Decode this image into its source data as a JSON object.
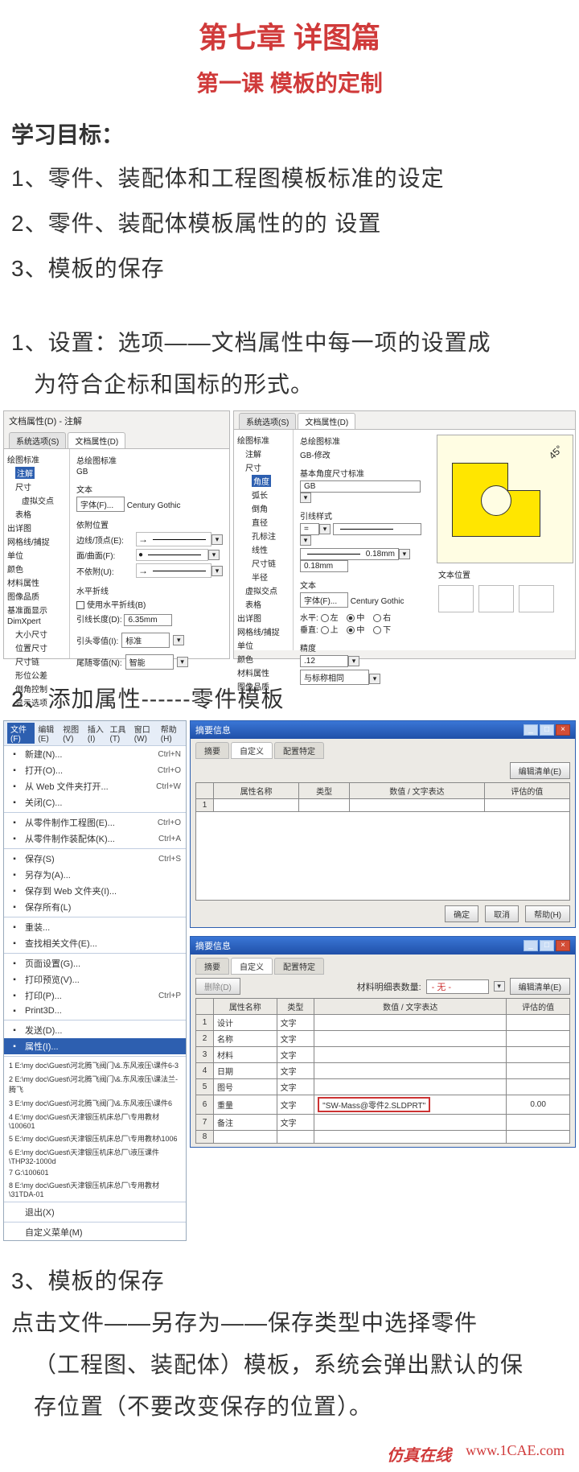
{
  "chapter_title": "第七章 详图篇",
  "lesson_title": "第一课   模板的定制",
  "goal_head": "学习目标：",
  "goals": [
    "1、零件、装配体和工程图模板标准的设定",
    "2、零件、装配体模板属性的的 设置",
    "3、模板的保存"
  ],
  "section1": "1、设置：选项——文档属性中每一项的设置成",
  "section1b": "为符合企标和国标的形式。",
  "dlgL": {
    "title": "文档属性(D) - 注解",
    "tabs": {
      "sys": "系统选项(S)",
      "doc": "文档属性(D)"
    },
    "tree": [
      "绘图标准",
      "注解",
      "尺寸",
      "虚拟交点",
      "表格",
      "出详图",
      "网格线/捕捉",
      "单位",
      "颜色",
      "材料属性",
      "图像品质",
      "基准面显示",
      "DimXpert",
      "大小尺寸",
      "位置尺寸",
      "尺寸链",
      "形位公差",
      "倒角控制",
      "显示选项"
    ],
    "tree_sel": "注解",
    "overall": "总绘图标准",
    "overall_v": "GB",
    "text": "文本",
    "font_btn": "字体(F)...",
    "font_val": "Century Gothic",
    "attach": "依附位置",
    "edge": "边线/顶点(E):",
    "face": "面/曲面(F):",
    "no": "不依附(U):",
    "hbreak": "水平折线",
    "hbreak_chk": "使用水平折线(B)",
    "lead_len": "引线长度(D):",
    "lead_len_v": "6.35mm",
    "lead_zero": "引头零值(I):",
    "lead_zero_v": "标准",
    "trail_zero": "尾随零值(N):",
    "trail_zero_v": "智能"
  },
  "dlgR": {
    "tabs": {
      "sys": "系统选项(S)",
      "doc": "文档属性(D)"
    },
    "tree": [
      "绘图标准",
      "注解",
      "尺寸",
      "角度",
      "弧长",
      "倒角",
      "直径",
      "孔标注",
      "线性",
      "尺寸链",
      "半径",
      "虚拟交点",
      "表格",
      "出详图",
      "网格线/捕捉",
      "单位",
      "颜色",
      "材料属性",
      "图像品质"
    ],
    "tree_sel": "角度",
    "overall": "总绘图标准",
    "overall_v": "GB-修改",
    "basic": "基本角度尺寸标准",
    "basic_v": "GB",
    "leadstyle": "引线样式",
    "thick_v": "0.18mm",
    "box_v": "0.18mm",
    "text": "文本",
    "font_btn": "字体(F)...",
    "font_val": "Century Gothic",
    "horiz": "水平:",
    "vert": "垂直:",
    "left": "左",
    "center": "中",
    "right": "右",
    "top": "上",
    "bottom": "下",
    "precision": "精度",
    "prec_v": ".12",
    "same": "与标称相同",
    "textpos": "文本位置",
    "angle_lbl": "45°"
  },
  "section2": "2、添加属性------零件模板",
  "menu": {
    "bar": [
      "文件(F)",
      "编辑(E)",
      "视图(V)",
      "插入(I)",
      "工具(T)",
      "窗口(W)",
      "帮助(H)"
    ],
    "items": [
      {
        "t": "新建(N)...",
        "k": "Ctrl+N"
      },
      {
        "t": "打开(O)...",
        "k": "Ctrl+O"
      },
      {
        "t": "从 Web 文件夹打开...",
        "k": "Ctrl+W"
      },
      {
        "t": "关闭(C)...",
        "k": ""
      },
      {
        "sep": true
      },
      {
        "t": "从零件制作工程图(E)...",
        "k": "Ctrl+O"
      },
      {
        "t": "从零件制作装配体(K)...",
        "k": "Ctrl+A"
      },
      {
        "sep": true
      },
      {
        "t": "保存(S)",
        "k": "Ctrl+S"
      },
      {
        "t": "另存为(A)...",
        "k": ""
      },
      {
        "t": "保存到 Web 文件夹(I)...",
        "k": ""
      },
      {
        "t": "保存所有(L)",
        "k": ""
      },
      {
        "sep": true
      },
      {
        "t": "重装...",
        "k": ""
      },
      {
        "t": "查找相关文件(E)...",
        "k": ""
      },
      {
        "sep": true
      },
      {
        "t": "页面设置(G)...",
        "k": ""
      },
      {
        "t": "打印预览(V)...",
        "k": ""
      },
      {
        "t": "打印(P)...",
        "k": "Ctrl+P"
      },
      {
        "t": "Print3D...",
        "k": ""
      },
      {
        "sep": true
      },
      {
        "t": "发送(D)...",
        "k": ""
      },
      {
        "t": "属性(I)...",
        "k": "",
        "sel": true
      },
      {
        "sep": true
      }
    ],
    "recent": [
      "1 E:\\my doc\\Guest\\河北腾飞阀门\\&.东风液压\\课件6-3",
      "2 E:\\my doc\\Guest\\河北腾飞阀门\\&.东风液压\\课法兰-腾飞",
      "3 E:\\my doc\\Guest\\河北腾飞阀门\\&.东风液压\\课件6",
      "4 E:\\my doc\\Guest\\天津银压机床总厂\\专用教材\\100601",
      "5 E:\\my doc\\Guest\\天津银压机床总厂\\专用教材\\1006",
      "6 E:\\my doc\\Guest\\天津银压机床总厂\\液压课件\\THP32-1000d",
      "7 G:\\100601",
      "8 E:\\my doc\\Guest\\天津银压机床总厂\\专用教材\\31TDA-01"
    ],
    "exit": "退出(X)",
    "custmenu": "自定义菜单(M)"
  },
  "win1": {
    "title": "摘要信息",
    "tabs": [
      "摘要",
      "自定义",
      "配置特定"
    ],
    "editlist": "编辑清单(E)",
    "cols": [
      "属性名称",
      "类型",
      "数值 / 文字表达",
      "评估的值"
    ],
    "ok": "确定",
    "cancel": "取消",
    "help": "帮助(H)"
  },
  "win2": {
    "title": "摘要信息",
    "tabs": [
      "摘要",
      "自定义",
      "配置特定"
    ],
    "bom": "材料明细表数量:",
    "bom_v": "- 无 -",
    "editlist": "编辑清单(E)",
    "del": "删除(D)",
    "cols": [
      "属性名称",
      "类型",
      "数值 / 文字表达",
      "评估的值"
    ],
    "rows": [
      {
        "n": "1",
        "name": "设计",
        "type": "文字",
        "expr": "",
        "val": ""
      },
      {
        "n": "2",
        "name": "名称",
        "type": "文字",
        "expr": "",
        "val": ""
      },
      {
        "n": "3",
        "name": "材料",
        "type": "文字",
        "expr": "",
        "val": ""
      },
      {
        "n": "4",
        "name": "日期",
        "type": "文字",
        "expr": "",
        "val": ""
      },
      {
        "n": "5",
        "name": "图号",
        "type": "文字",
        "expr": "",
        "val": ""
      },
      {
        "n": "6",
        "name": "重量",
        "type": "文字",
        "expr": "\"SW-Mass@零件2.SLDPRT\"",
        "val": "0.00",
        "red": true
      },
      {
        "n": "7",
        "name": "备注",
        "type": "文字",
        "expr": "",
        "val": ""
      },
      {
        "n": "8",
        "name": "",
        "type": "",
        "expr": "",
        "val": ""
      }
    ]
  },
  "section3": "3、模板的保存",
  "section3_p1": "点击文件——另存为——保存类型中选择零件",
  "section3_p2": "（工程图、装配体）模板，系统会弹出默认的保",
  "section3_p3": "存位置（不要改变保存的位置）。",
  "footer": {
    "brand": "仿真在线",
    "url": "www.1CAE.com"
  }
}
